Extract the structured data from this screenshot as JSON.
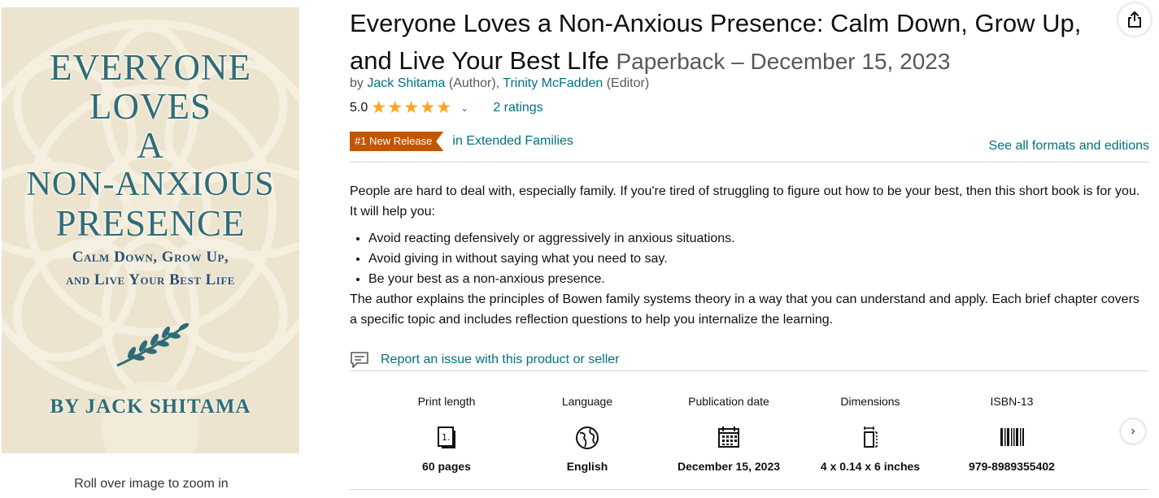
{
  "cover": {
    "title_lines": [
      "EVERYONE",
      "LOVES",
      "A",
      "NON-ANXIOUS",
      "PRESENCE"
    ],
    "subtitle_lines": [
      "Calm Down, Grow Up,",
      "and Live Your Best Life"
    ],
    "author": "BY JACK SHITAMA",
    "zoom_hint": "Roll over image to zoom in",
    "colors": {
      "background": "#ece4cf",
      "title": "#2f6c78",
      "subtitle": "#2a4f70"
    }
  },
  "product": {
    "title": "Everyone Loves a Non-Anxious Presence: Calm Down, Grow Up, and Live Your Best LIfe",
    "binding_date": "Paperback – December 15, 2023",
    "byline": {
      "prefix": "by",
      "author_name": "Jack Shitama",
      "author_role": "(Author),",
      "editor_name": "Trinity McFadden",
      "editor_role": "(Editor)"
    },
    "rating": {
      "value": "5.0",
      "stars": 5,
      "ratings_text": "2 ratings"
    },
    "badge": {
      "label": "#1 New Release",
      "category": "in Extended Families",
      "color": "#c45500"
    },
    "formats_link": "See all formats and editions",
    "share_icon": "share-icon"
  },
  "description": {
    "intro": "People are hard to deal with, especially family. If you're tired of struggling to figure out how to be your best, then this short book is for you. It will help you:",
    "bullets": [
      "Avoid reacting defensively or aggressively in anxious situations.",
      "Avoid giving in without saying what you need to say.",
      "Be your best as a non-anxious presence."
    ],
    "closing": "The author explains the principles of Bowen family systems theory in a way that you can understand and apply. Each brief chapter covers a specific topic and includes reflection questions to help you internalize the learning."
  },
  "report_link": "Report an issue with this product or seller",
  "attributes": [
    {
      "label": "Print length",
      "icon": "page-count-icon",
      "value": "60 pages"
    },
    {
      "label": "Language",
      "icon": "globe-icon",
      "value": "English"
    },
    {
      "label": "Publication date",
      "icon": "calendar-icon",
      "value": "December 15, 2023"
    },
    {
      "label": "Dimensions",
      "icon": "dimensions-icon",
      "value": "4 x 0.14 x 6 inches"
    },
    {
      "label": "ISBN-13",
      "icon": "barcode-icon",
      "value": "979-8989355402"
    }
  ],
  "colors": {
    "link": "#007185",
    "star": "#ffa41c",
    "text": "#0f1111",
    "muted": "#565959"
  }
}
